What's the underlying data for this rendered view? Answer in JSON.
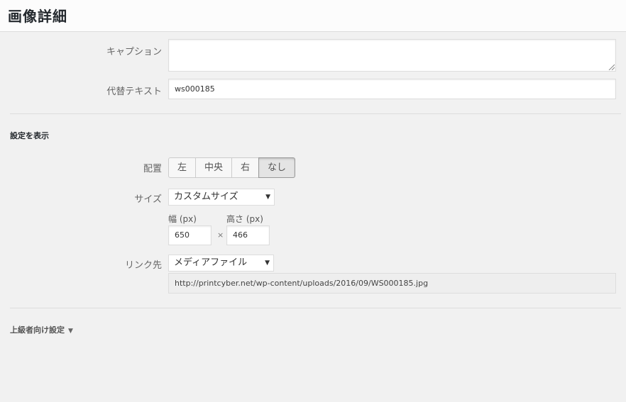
{
  "header": {
    "title": "画像詳細"
  },
  "caption": {
    "label": "キャプション",
    "value": ""
  },
  "alt": {
    "label": "代替テキスト",
    "value": "ws000185"
  },
  "display_settings": {
    "title": "設定を表示"
  },
  "alignment": {
    "label": "配置",
    "options": [
      "左",
      "中央",
      "右",
      "なし"
    ],
    "selected": "なし"
  },
  "size": {
    "label": "サイズ",
    "selected": "カスタムサイズ",
    "width_label": "幅 (px)",
    "height_label": "高さ (px)",
    "width_value": "650",
    "height_value": "466",
    "times": "×"
  },
  "link": {
    "label": "リンク先",
    "selected": "メディアファイル",
    "url": "http://printcyber.net/wp-content/uploads/2016/09/WS000185.jpg"
  },
  "advanced": {
    "label": "上級者向け設定"
  },
  "icons": {
    "dropdown": "▼",
    "expand": "▼"
  }
}
